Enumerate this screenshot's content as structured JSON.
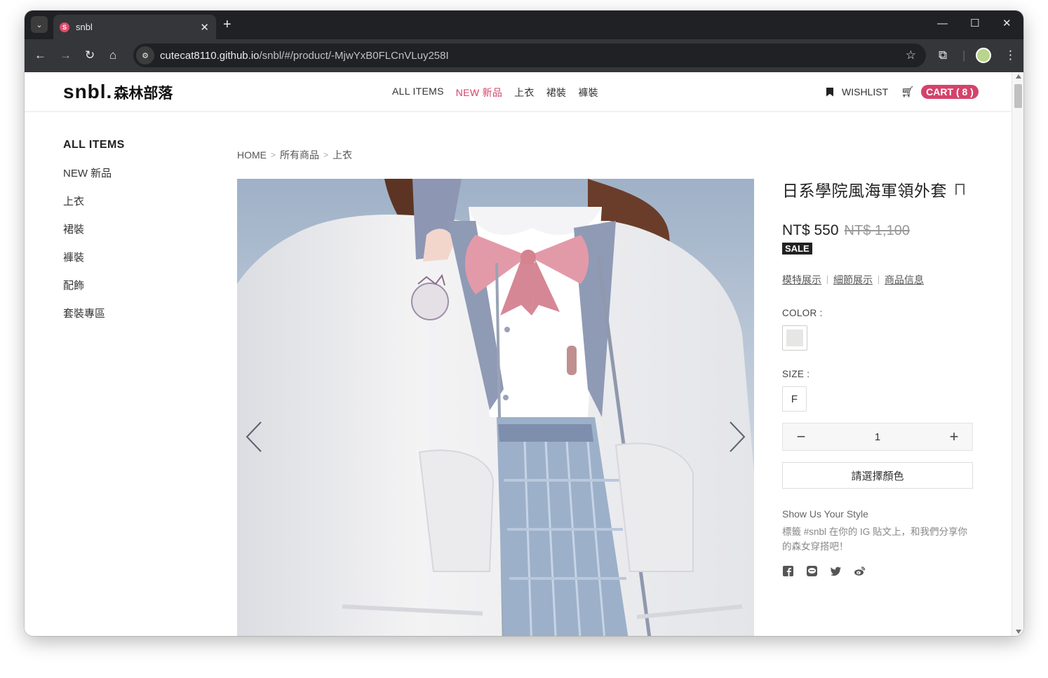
{
  "browser": {
    "tab_title": "snbl",
    "tab_favicon": "S",
    "url_host": "cutecat8110.github.io",
    "url_path": "/snbl/#/product/-MjwYxB0FLCnVLuy258I",
    "icons": [
      "tab-search-icon",
      "close-icon",
      "new-tab-icon",
      "minimize-icon",
      "maximize-icon",
      "window-close-icon",
      "back-icon",
      "forward-icon",
      "reload-icon",
      "home-icon",
      "site-info-icon",
      "star-icon",
      "extensions-icon",
      "profile-avatar",
      "menu-icon"
    ]
  },
  "header": {
    "logo": "snbl.",
    "logo_sub": "森林部落",
    "nav": [
      {
        "label": "ALL ITEMS",
        "highlight": false
      },
      {
        "label": "NEW 新品",
        "highlight": true
      },
      {
        "label": "上衣",
        "highlight": false
      },
      {
        "label": "裙裝",
        "highlight": false
      },
      {
        "label": "褲裝",
        "highlight": false
      }
    ],
    "wishlist_label": "WISHLIST",
    "cart_label": "CART ( 8 )",
    "accent_color": "#d4436a"
  },
  "sidebar": {
    "title": "ALL ITEMS",
    "items": [
      {
        "label": "NEW 新品"
      },
      {
        "label": "上衣"
      },
      {
        "label": "裙裝"
      },
      {
        "label": "褲裝"
      },
      {
        "label": "配飾"
      },
      {
        "label": "套裝專區"
      }
    ]
  },
  "breadcrumb": [
    "HOME",
    "所有商品",
    "上衣"
  ],
  "product": {
    "title": "日系學院風海軍領外套",
    "price": "NT$ 550",
    "original_price": "NT$ 1,100",
    "badge": "SALE",
    "tabs": [
      "模特展示",
      "細節展示",
      "商品信息"
    ],
    "color_label": "COLOR :",
    "color_swatch": "#e6e6e4",
    "size_label": "SIZE :",
    "size_option": "F",
    "quantity": "1",
    "select_button": "請選擇顏色",
    "style_heading": "Show Us Your Style",
    "style_text": "標籤 #snbl 在你的 IG 貼文上，和我們分享你的森女穿搭吧！",
    "social_icons": [
      "facebook-icon",
      "line-icon",
      "twitter-icon",
      "weibo-icon"
    ]
  }
}
